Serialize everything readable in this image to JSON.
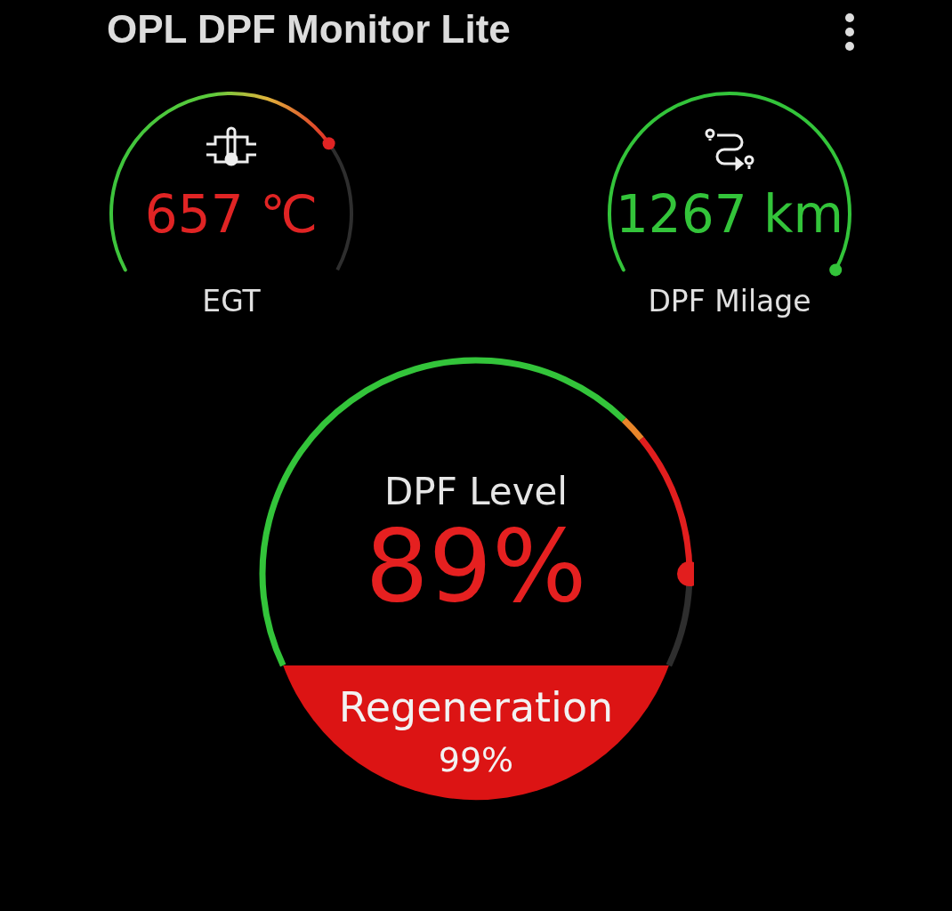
{
  "app_bar": {
    "title": "OPL DPF Monitor Lite"
  },
  "gauges": [
    {
      "kind": "temperature",
      "value": "657 ℃",
      "label": "EGT",
      "color": "#e02424"
    },
    {
      "kind": "distance",
      "value": "1267 km",
      "label": "DPF Milage",
      "color": "#33c43a"
    }
  ],
  "dpf": {
    "title": "DPF Level",
    "value": "89%",
    "regeneration": {
      "label": "Regeneration",
      "value": "99%"
    }
  }
}
